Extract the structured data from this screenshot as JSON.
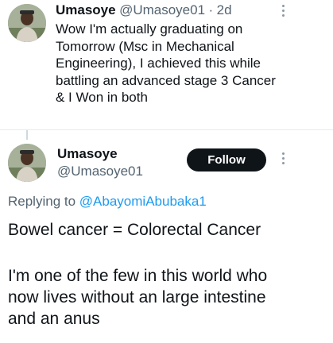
{
  "first_tweet": {
    "display_name": "Umasoye",
    "handle": "@Umasoye01",
    "separator": "·",
    "time": "2d",
    "lines": [
      "Wow I'm actually graduating on",
      "Tomorrow (Msc in Mechanical",
      "Engineering), I achieved this while",
      "battling an advanced stage 3 Cancer",
      "& I Won in both"
    ]
  },
  "second_tweet": {
    "display_name": "Umasoye",
    "handle": "@Umasoye01",
    "follow_label": "Follow",
    "replying_to_label": "Replying to",
    "replying_to_handle": "@AbayomiAbubaka1",
    "lines": [
      "Bowel cancer = Colorectal Cancer",
      "",
      "I'm one of the few in this world who",
      "now lives without an large intestine",
      "and an anus"
    ]
  },
  "icons": {
    "avatar": "avatar-photo",
    "more": "more-vertical-icon"
  },
  "colors": {
    "text": "#0f1419",
    "secondary": "#536471",
    "mention": "#1d9bf0",
    "follow_bg": "#0f1419"
  }
}
